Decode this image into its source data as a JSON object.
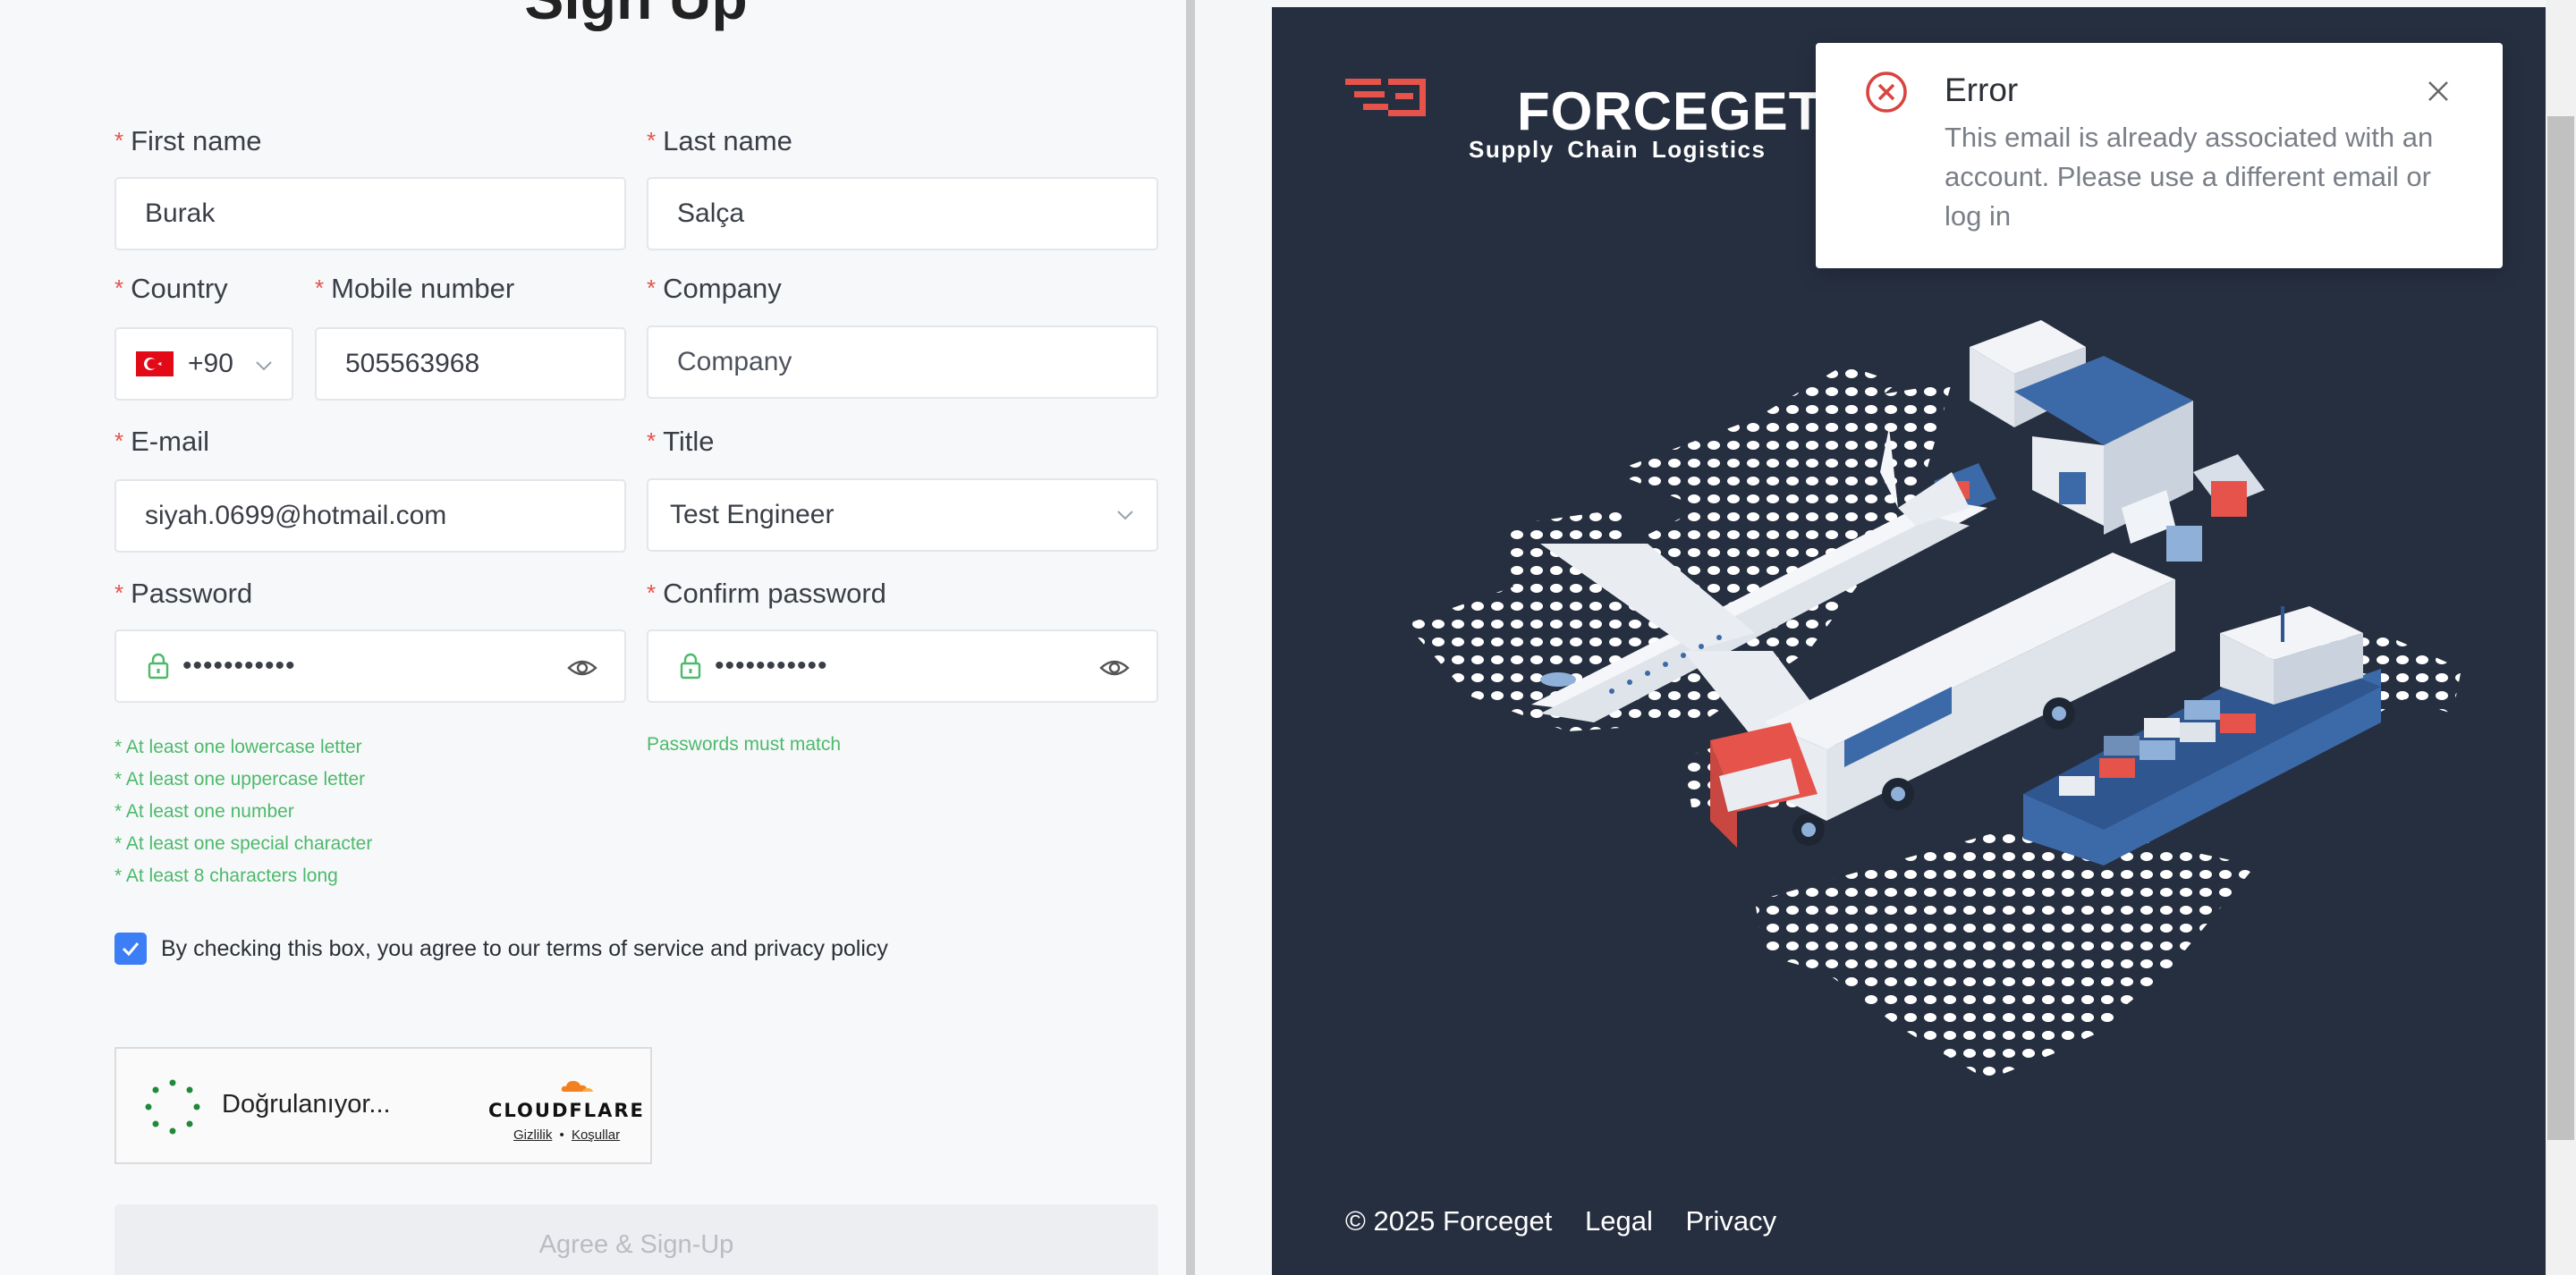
{
  "form": {
    "title": "Sign Up",
    "first_name": {
      "label": "First name",
      "value": "Burak"
    },
    "last_name": {
      "label": "Last name",
      "value": "Salça"
    },
    "country": {
      "label": "Country",
      "flag": "turkey-flag-icon",
      "value": "+90"
    },
    "mobile": {
      "label": "Mobile number",
      "value": "505563968"
    },
    "company": {
      "label": "Company",
      "placeholder": "Company"
    },
    "email": {
      "label": "E-mail",
      "value": "siyah.0699@hotmail.com"
    },
    "title_field": {
      "label": "Title",
      "value": "Test Engineer"
    },
    "password": {
      "label": "Password",
      "value": "•••••••••••"
    },
    "confirm_password": {
      "label": "Confirm password",
      "value": "•••••••••••"
    },
    "password_hints": [
      "* At least one lowercase letter",
      "* At least one uppercase letter",
      "* At least one number",
      "* At least one special character",
      "* At least 8 characters long"
    ],
    "confirm_hint": "Passwords must match",
    "consent": {
      "checked": true,
      "text": "By checking this box, you agree to our terms of service and privacy policy"
    },
    "submit_label": "Agree & Sign-Up"
  },
  "captcha": {
    "status": "Doğrulanıyor...",
    "brand": "CLOUDFLARE",
    "privacy": "Gizlilik",
    "separator": "•",
    "terms": "Koşullar"
  },
  "brand": {
    "logo_word": "FORCEGET",
    "tagline": "Supply Chain Logistics",
    "footer_copyright": "© 2025 Forceget",
    "footer_legal": "Legal",
    "footer_privacy": "Privacy"
  },
  "toast": {
    "title": "Error",
    "message": "This email is already associated with an account. Please use a different email or log in"
  },
  "colors": {
    "required": "#e5534b",
    "hint": "#4cba6b",
    "checkbox": "#3c7ef5",
    "brand_bg": "#262f40",
    "logo_red": "#e5534b",
    "error": "#d9443f"
  }
}
